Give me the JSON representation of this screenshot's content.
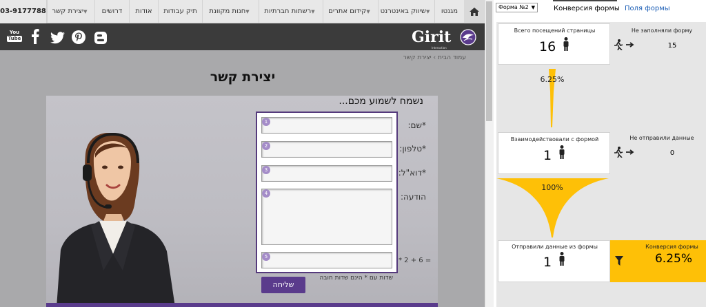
{
  "site": {
    "nav": {
      "phone": "03-9177788",
      "items": [
        {
          "label": "יצירת קשר",
          "dropdown": true
        },
        {
          "label": "דרושים",
          "dropdown": false
        },
        {
          "label": "אודות",
          "dropdown": false
        },
        {
          "label": "תיק עבודות",
          "dropdown": false
        },
        {
          "label": "חנות מקוונת",
          "dropdown": true
        },
        {
          "label": "רשתות חברתיות",
          "dropdown": true
        },
        {
          "label": "קידום אתרים",
          "dropdown": true
        },
        {
          "label": "שיווק באינטרנט",
          "dropdown": true
        },
        {
          "label": "מגנטו",
          "dropdown": false
        }
      ],
      "home_icon": "home-icon"
    },
    "social_icons": [
      "youtube-icon",
      "facebook-icon",
      "twitter-icon",
      "pinterest-icon",
      "blogger-icon"
    ],
    "social_labels": {
      "youtube_top": "You",
      "youtube_bottom": "Tube"
    },
    "logo": {
      "name": "Girit",
      "sub": "Interaction"
    },
    "breadcrumb": "עמוד הבית › יצירת קשר",
    "page_title": "יצירת קשר",
    "form": {
      "subtitle": "נשמח לשמוע מכם...",
      "fields": [
        {
          "label": "*שם:",
          "num": "1"
        },
        {
          "label": "*טלפון:",
          "num": "2"
        },
        {
          "label": "*דוא\"ל:",
          "num": "3"
        },
        {
          "label": "הודעה:",
          "num": "4"
        },
        {
          "label": "",
          "num": "5"
        }
      ],
      "captcha": "* 2 + 6 =",
      "required_note": "שדות עם * הינם שדות חובה",
      "send_label": "שליחה"
    }
  },
  "panel": {
    "form_select": {
      "value": "Форма №2"
    },
    "tabs": {
      "conversion": "Конверсия формы",
      "fields": "Поля формы"
    },
    "stages": {
      "visits": {
        "title": "Всего посещений страницы",
        "value": "16"
      },
      "not_filled": {
        "title": "Не заполняли форму",
        "value": "15"
      },
      "interacted": {
        "title": "Взаимодействовали с формой",
        "value": "1"
      },
      "not_sent": {
        "title": "Не отправили данные",
        "value": "0"
      },
      "sent": {
        "title": "Отправили данные из формы",
        "value": "1"
      },
      "conversion": {
        "title": "Конверсия формы",
        "value": "6.25%"
      }
    },
    "funnel": {
      "step1_pct": "6.25%",
      "step2_pct": "100%"
    },
    "colors": {
      "accent": "#fec007",
      "link": "#1a5db5",
      "brand_purple": "#5a3b8c"
    }
  }
}
